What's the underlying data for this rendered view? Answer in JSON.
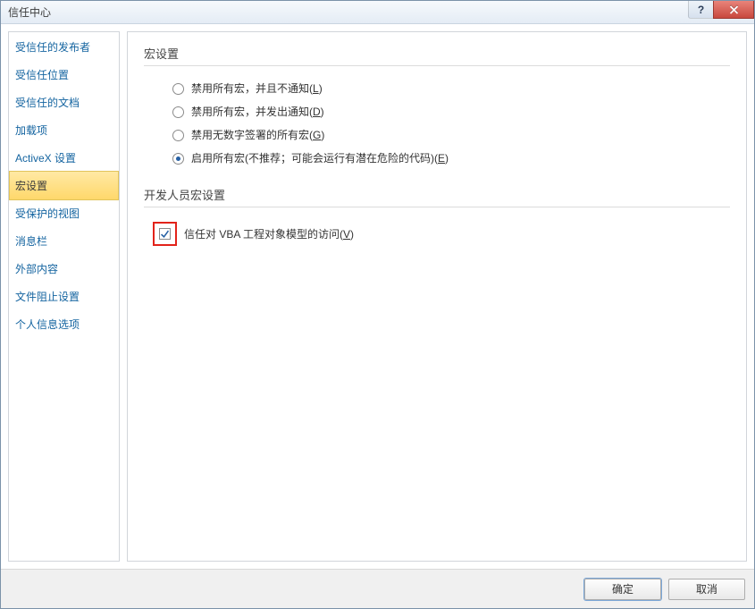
{
  "window": {
    "title": "信任中心"
  },
  "sidebar": {
    "items": [
      {
        "label": "受信任的发布者",
        "selected": false
      },
      {
        "label": "受信任位置",
        "selected": false
      },
      {
        "label": "受信任的文档",
        "selected": false
      },
      {
        "label": "加载项",
        "selected": false
      },
      {
        "label": "ActiveX 设置",
        "selected": false
      },
      {
        "label": "宏设置",
        "selected": true
      },
      {
        "label": "受保护的视图",
        "selected": false
      },
      {
        "label": "消息栏",
        "selected": false
      },
      {
        "label": "外部内容",
        "selected": false
      },
      {
        "label": "文件阻止设置",
        "selected": false
      },
      {
        "label": "个人信息选项",
        "selected": false
      }
    ]
  },
  "main": {
    "section1_title": "宏设置",
    "radios": [
      {
        "label": "禁用所有宏，并且不通知",
        "accel": "L",
        "checked": false
      },
      {
        "label": "禁用所有宏，并发出通知",
        "accel": "D",
        "checked": false
      },
      {
        "label": "禁用无数字签署的所有宏",
        "accel": "G",
        "checked": false
      },
      {
        "label": "启用所有宏(不推荐；可能会运行有潜在危险的代码)",
        "accel": "E",
        "checked": true
      }
    ],
    "section2_title": "开发人员宏设置",
    "vba_checkbox": {
      "label": "信任对 VBA 工程对象模型的访问",
      "accel": "V",
      "checked": true,
      "highlighted": true
    }
  },
  "footer": {
    "ok": "确定",
    "cancel": "取消"
  }
}
